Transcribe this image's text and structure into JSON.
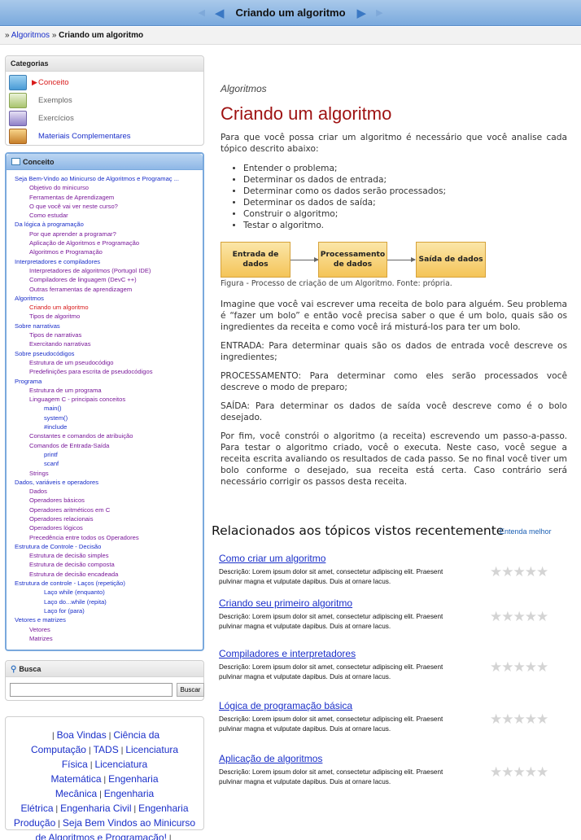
{
  "header": {
    "title": "Criando um algoritmo"
  },
  "breadcrumb": {
    "prefix": "» ",
    "parent": "Algoritmos",
    "separator": " » ",
    "current": "Criando um algoritmo"
  },
  "categories": {
    "title": "Categorias",
    "items": [
      {
        "label": "Conceito",
        "icon": "book-icon",
        "color": "#d81a1a"
      },
      {
        "label": "Exemplos",
        "icon": "doc-icon",
        "color": "#666666"
      },
      {
        "label": "Exercícios",
        "icon": "pencil-icon",
        "color": "#666666"
      },
      {
        "label": "Materiais Complementares",
        "icon": "books-icon",
        "color": "#1a2fc9"
      }
    ]
  },
  "concept": {
    "title": "Conceito",
    "tree": [
      {
        "label": "Seja Bem-Vindo ao Minicurso de Algoritmos e Programaç ...",
        "level": 0
      },
      {
        "label": "Objetivo do minicurso",
        "level": 1
      },
      {
        "label": "Ferramentas de Aprendizagem",
        "level": 1
      },
      {
        "label": "O que você vai ver neste curso?",
        "level": 1
      },
      {
        "label": "Como estudar",
        "level": 1
      },
      {
        "label": "Da lógica à programação",
        "level": 0
      },
      {
        "label": "Por que aprender a programar?",
        "level": 1
      },
      {
        "label": "Aplicação de Algoritmos e Programação",
        "level": 1
      },
      {
        "label": "Algoritmos e Programação",
        "level": 1
      },
      {
        "label": "Interpretadores e compiladores",
        "level": 0
      },
      {
        "label": "Interpretadores de algoritmos (Portugol IDE)",
        "level": 1
      },
      {
        "label": "Compiladores de linguagem (DevC ++)",
        "level": 1
      },
      {
        "label": "Outras ferramentas de aprendizagem",
        "level": 1
      },
      {
        "label": "Algoritmos",
        "level": 0
      },
      {
        "label": "Criando um algoritmo",
        "level": 1,
        "current": true
      },
      {
        "label": "Tipos de algoritmo",
        "level": 1
      },
      {
        "label": "Sobre narrativas",
        "level": 0
      },
      {
        "label": "Tipos de narrativas",
        "level": 1
      },
      {
        "label": "Exercitando narrativas",
        "level": 1
      },
      {
        "label": "Sobre pseudocódigos",
        "level": 0
      },
      {
        "label": "Estrutura de um pseudocódigo",
        "level": 1
      },
      {
        "label": "Predefinições para escrita de pseudocódigos",
        "level": 1
      },
      {
        "label": "Programa",
        "level": 0
      },
      {
        "label": "Estrutura de um programa",
        "level": 1
      },
      {
        "label": "Linguagem C - principais conceitos",
        "level": 1
      },
      {
        "label": "main()",
        "level": 2
      },
      {
        "label": "system()",
        "level": 2
      },
      {
        "label": "#include",
        "level": 2
      },
      {
        "label": "Constantes e comandos de atribuição",
        "level": 1
      },
      {
        "label": "Comandos de Entrada-Saída",
        "level": 1
      },
      {
        "label": "printf",
        "level": 2
      },
      {
        "label": "scanf",
        "level": 2
      },
      {
        "label": "Strings",
        "level": 1
      },
      {
        "label": "Dados, variáveis e operadores",
        "level": 0
      },
      {
        "label": "Dados",
        "level": 1
      },
      {
        "label": "Operadores básicos",
        "level": 1
      },
      {
        "label": "Operadores aritméticos em C",
        "level": 1
      },
      {
        "label": "Operadores relacionais",
        "level": 1
      },
      {
        "label": "Operadores lógicos",
        "level": 1
      },
      {
        "label": "Precedência entre todos os Operadores",
        "level": 1
      },
      {
        "label": "Estrutura de Controle - Decisão",
        "level": 0
      },
      {
        "label": "Estrutura de decisão simples",
        "level": 1
      },
      {
        "label": "Estrutura de decisão composta",
        "level": 1
      },
      {
        "label": "Estrutura de decisão encadeada",
        "level": 1
      },
      {
        "label": "Estrutura de controle - Laços (repetição)",
        "level": 0
      },
      {
        "label": "Laço while (enquanto)",
        "level": 2
      },
      {
        "label": "Laço do...while (repita)",
        "level": 2
      },
      {
        "label": "Laço for (para)",
        "level": 2
      },
      {
        "label": "Vetores e matrizes",
        "level": 0
      },
      {
        "label": "Vetores",
        "level": 1
      },
      {
        "label": "Matrizes",
        "level": 1
      }
    ]
  },
  "search": {
    "title": "Busca",
    "value": "",
    "button": "Buscar"
  },
  "links": [
    "Boa Vindas",
    "Ciência da Computação",
    "TADS",
    "Licenciatura Física",
    "Licenciatura Matemática",
    "Engenharia Mecânica",
    "Engenharia Elétrica",
    "Engenharia Civil",
    "Engenharia Produção",
    "Seja Bem Vindos ao Minicurso de Algoritmos e Programação!"
  ],
  "main": {
    "section": "Algoritmos",
    "title": "Criando um algoritmo",
    "intro": "Para que você possa criar um algoritmo é necessário que você analise cada tópico descrito abaixo:",
    "steps": [
      "Entender o problema;",
      "Determinar os dados de entrada;",
      "Determinar como os dados serão processados;",
      "Determinar os dados de saída;",
      "Construir o algoritmo;",
      "Testar o algoritmo."
    ],
    "flow": [
      "Entrada de dados",
      "Processamento de dados",
      "Saída de dados"
    ],
    "caption": "Figura - Processo de criação de um Algoritmo. Fonte: própria.",
    "paragraphs": [
      "Imagine que você vai escrever uma receita de bolo para alguém. Seu problema é “fazer um bolo” e então você precisa saber o que é um bolo, quais são os ingredientes da receita e como você irá misturá-los para ter um bolo.",
      "ENTRADA: Para determinar quais são os dados de entrada você descreve os ingredientes;",
      "PROCESSAMENTO: Para determinar como eles serão processados você descreve o modo de preparo;",
      "SAÍDA: Para determinar os dados de saída você descreve como é o bolo desejado.",
      "Por fim, você constrói o algoritmo (a receita) escrevendo um passo-a-passo. Para testar o algoritmo criado, você o executa. Neste caso, você segue a receita escrita avaliando os resultados de cada passo. Se no final você tiver um bolo conforme o desejado, sua receita está certa. Caso contrário será necessário corrigir os passos desta receita."
    ]
  },
  "related": {
    "title": "Relacionados aos tópicos vistos recentemente",
    "more": "Entenda melhor",
    "items": [
      {
        "title": "Como criar um algoritmo",
        "desc": "Descrição: Lorem ipsum dolor sit amet, consectetur adipiscing elit. Praesent pulvinar magna et vulputate dapibus. Duis at ornare lacus.",
        "stars": "★★★★★"
      },
      {
        "title": "Criando seu primeiro algoritmo",
        "desc": "Descrição: Lorem ipsum dolor sit amet, consectetur adipiscing elit. Praesent pulvinar magna et vulputate dapibus. Duis at ornare lacus.",
        "stars": "★★★★★"
      },
      {
        "title": "Compiladores e interpretadores",
        "desc": "Descrição: Lorem ipsum dolor sit amet, consectetur adipiscing elit. Praesent pulvinar magna et vulputate dapibus. Duis at ornare lacus.",
        "stars": "★★★★★"
      },
      {
        "title": "Lógica de programação básica",
        "desc": "Descrição: Lorem ipsum dolor sit amet, consectetur adipiscing elit. Praesent pulvinar magna et vulputate dapibus. Duis at ornare lacus.",
        "stars": "★★★★★"
      },
      {
        "title": "Aplicação de algoritmos",
        "desc": "Descrição: Lorem ipsum dolor sit amet, consectetur adipiscing elit. Praesent pulvinar magna et vulputate dapibus. Duis at ornare lacus.",
        "stars": "★★★★★"
      }
    ]
  }
}
